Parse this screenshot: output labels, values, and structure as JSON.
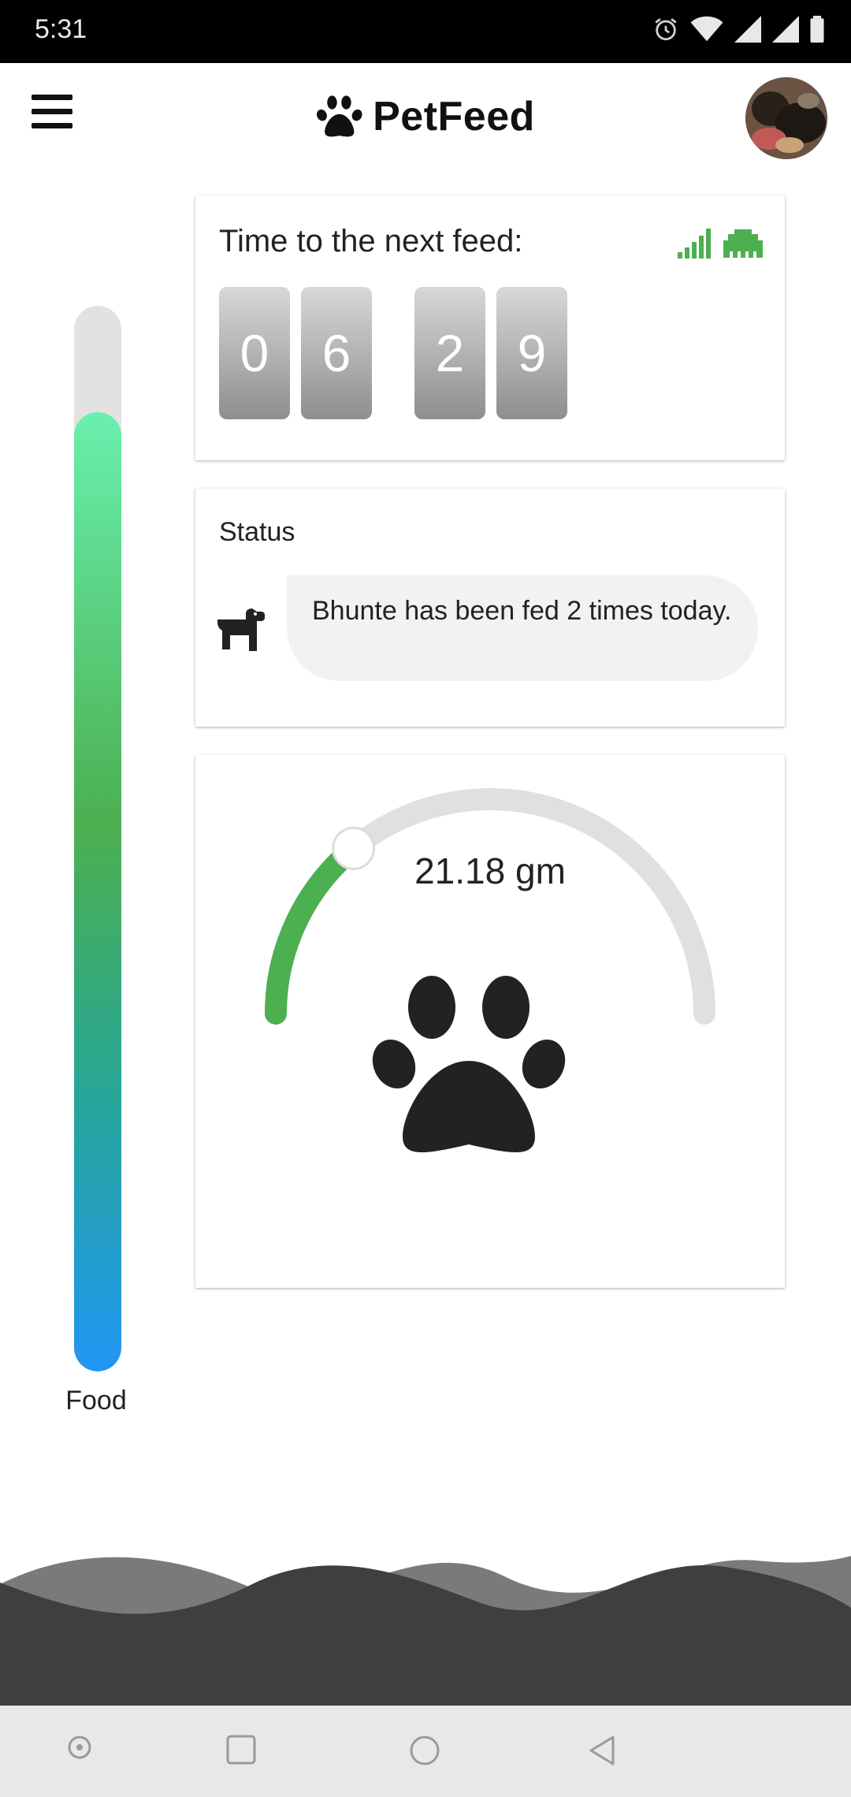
{
  "status_bar": {
    "time": "5:31"
  },
  "app": {
    "title": "PetFeed"
  },
  "feed_timer": {
    "title": "Time to the next feed:",
    "digits": [
      "0",
      "6",
      "2",
      "9"
    ]
  },
  "status": {
    "title": "Status",
    "message": "Bhunte has been fed 2 times today."
  },
  "gauge": {
    "value_text": "21.18 gm",
    "fraction": 0.28
  },
  "food_level": {
    "label": "Food",
    "fraction": 0.9
  },
  "colors": {
    "accent_green": "#4caf50",
    "gauge_track": "#e0e0e0",
    "level_top": "#69f0ae",
    "level_bottom": "#2196f3"
  },
  "icons": {
    "menu": "hamburger-icon",
    "brand": "paw-icon",
    "signal": "signal-bars-icon",
    "network": "ethernet-icon",
    "pet": "dog-icon",
    "gauge_center": "paw-icon"
  }
}
